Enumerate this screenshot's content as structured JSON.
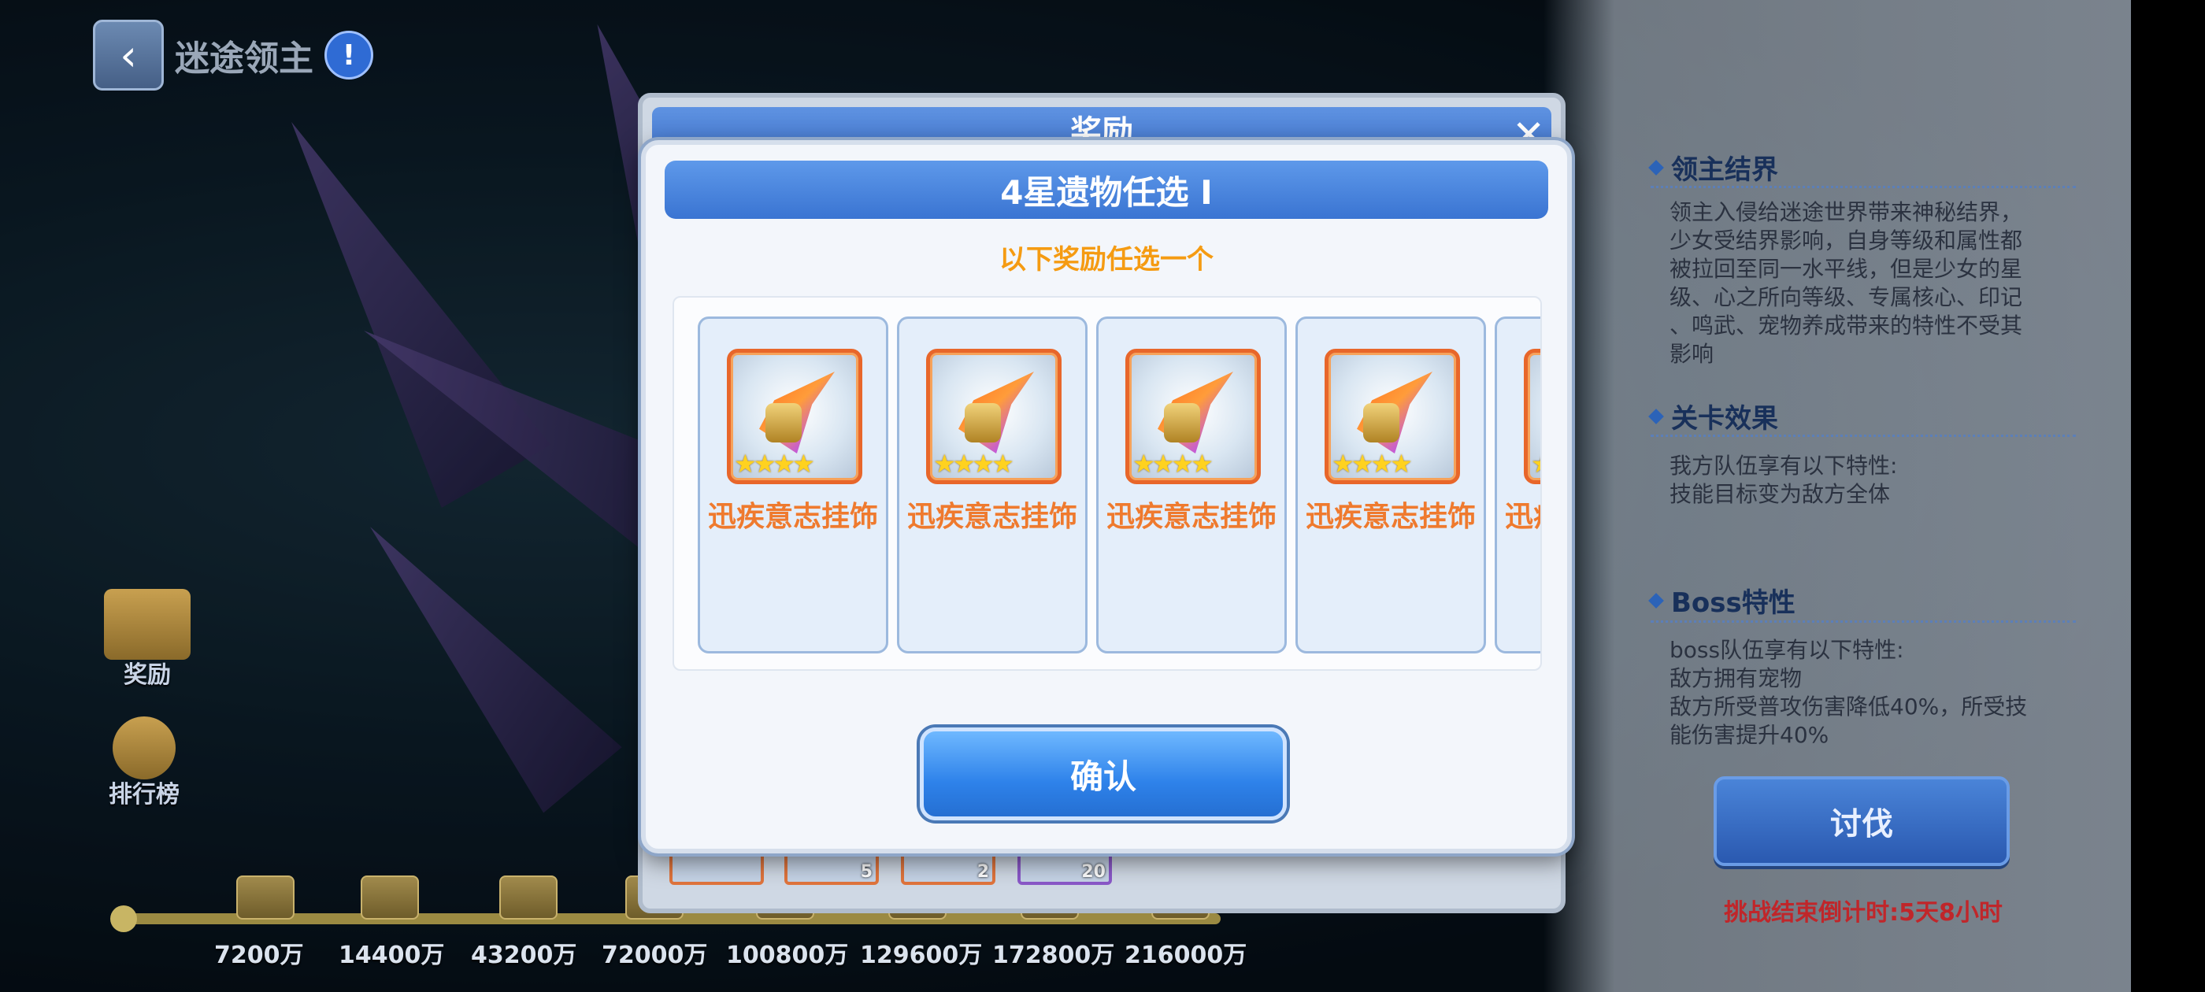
{
  "header": {
    "title": "迷途领主",
    "back_icon": "chevron-left-icon",
    "info_icon": "exclamation-icon"
  },
  "side_buttons": [
    {
      "label": "奖励",
      "icon": "mail-icon"
    },
    {
      "label": "排行榜",
      "icon": "medal-icon"
    }
  ],
  "milestones": [
    "7200万",
    "14400万",
    "43200万",
    "72000万",
    "100800万",
    "129600万",
    "172800万",
    "216000万"
  ],
  "right_panel": {
    "sections": [
      {
        "title": "领主结界",
        "lines": [
          "领主入侵给迷途世界带来神秘结界，",
          "少女受结界影响，自身等级和属性都",
          "被拉回至同一水平线，但是少女的星",
          "级、心之所向等级、专属核心、印记",
          "、鸣武、宠物养成带来的特性不受其",
          "影响"
        ]
      },
      {
        "title": "关卡效果",
        "lines": [
          "我方队伍享有以下特性:",
          "技能目标变为敌方全体"
        ]
      },
      {
        "title": "Boss特性",
        "lines": [
          "boss队伍享有以下特性:",
          "敌方拥有宠物",
          "敌方所受普攻伤害降低40%，所受技",
          "能伤害提升40%"
        ]
      }
    ],
    "attack_button": "讨伐",
    "countdown": "挑战结束倒计时:5天8小时"
  },
  "back_dialog": {
    "title": "奖励",
    "items": [
      {
        "count": ""
      },
      {
        "count": "5"
      },
      {
        "count": "2"
      },
      {
        "count": "20"
      }
    ]
  },
  "dialog": {
    "title": "4星遗物任选 Ⅰ",
    "subtitle": "以下奖励任选一个",
    "options": [
      {
        "name": "迅疾意志挂饰",
        "stars": "★★★★"
      },
      {
        "name": "迅疾意志挂饰",
        "stars": "★★★★"
      },
      {
        "name": "迅疾意志挂饰",
        "stars": "★★★★"
      },
      {
        "name": "迅疾意志挂饰",
        "stars": "★★★★"
      },
      {
        "name": "迅疾意志挂饰",
        "stars": "★★★★"
      }
    ],
    "confirm": "确认"
  }
}
